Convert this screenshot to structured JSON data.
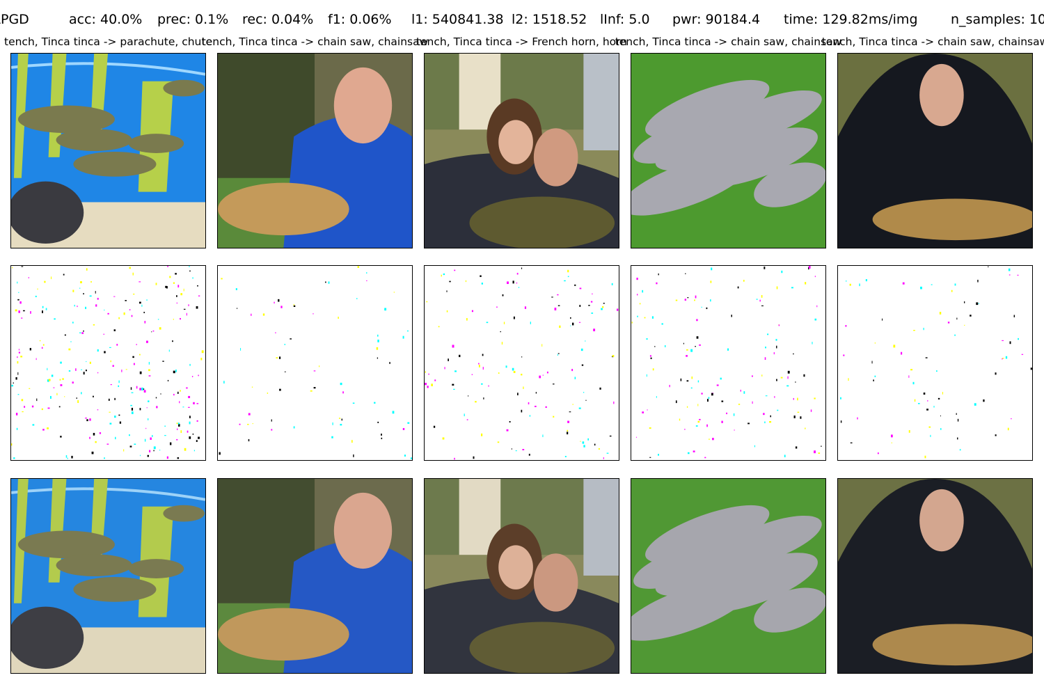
{
  "header": {
    "attack": "APGD",
    "acc": "acc: 40.0%",
    "prec": "prec: 0.1%",
    "rec": "rec: 0.04%",
    "f1": "f1: 0.06%",
    "l1": "l1: 540841.38",
    "l2": "l2: 1518.52",
    "linf": "lInf: 5.0",
    "pwr": "pwr: 90184.4",
    "time": "time: 129.82ms/img",
    "n_samples": "n_samples: 10"
  },
  "columns": [
    {
      "title": "tench, Tinca tinca -> parachute, chute",
      "scene": "aquarium-with-tench"
    },
    {
      "title": "tench, Tinca tinca -> chain saw, chainsaw",
      "scene": "man-in-blue-jacket-holding-tench"
    },
    {
      "title": "tench, Tinca tinca -> French horn, horn",
      "scene": "girl-and-man-holding-tench"
    },
    {
      "title": "tench, Tinca tinca -> chain saw, chainsaw",
      "scene": "pile-of-fish-on-grass"
    },
    {
      "title": "tench, Tinca tinca -> chain saw, chainsaw",
      "scene": "boy-in-black-hoodie-holding-tench"
    }
  ],
  "rows": [
    "original",
    "perturbation",
    "adversarial"
  ],
  "colors": {
    "perturbation_cyan": "#00ffff",
    "perturbation_yellow": "#ffff00",
    "perturbation_magenta": "#ff00ff",
    "aquarium_blue": "#1f86e6",
    "jacket_blue": "#1f55c9",
    "grass_green": "#4d9a2f",
    "hoodie_black": "#15181f",
    "fish_gold": "#b08a4a"
  }
}
